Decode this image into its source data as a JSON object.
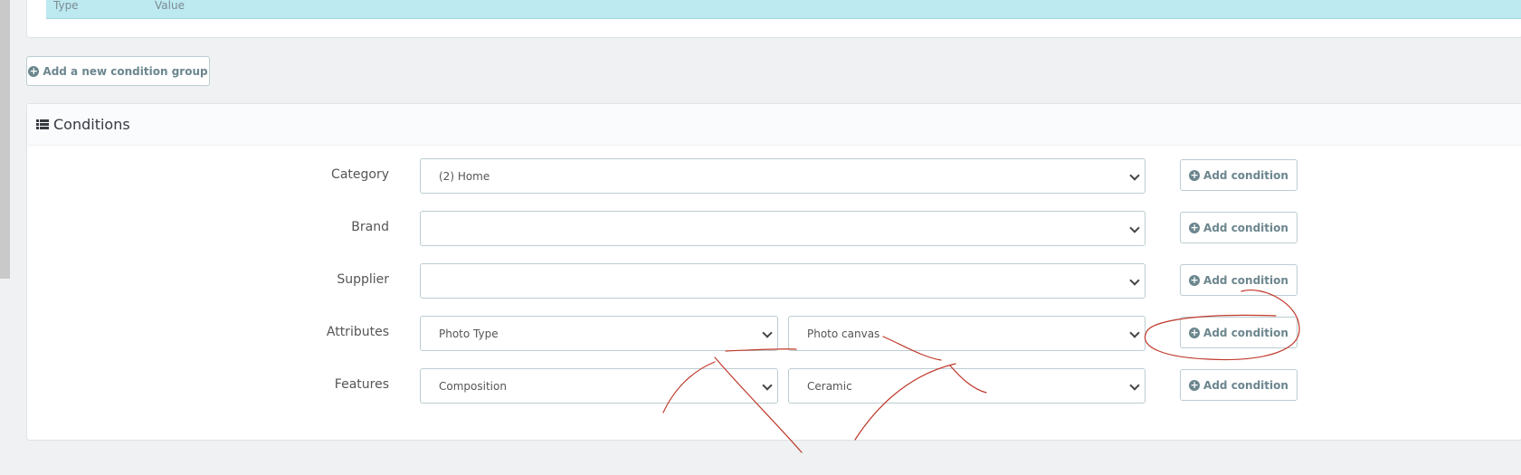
{
  "top_table": {
    "col_type": "Type",
    "col_value": "Value"
  },
  "new_group_button": {
    "label": "Add a new condition group",
    "icon": "plus-circle-icon"
  },
  "conditions": {
    "title": "Conditions",
    "icon": "list-icon",
    "rows": [
      {
        "label": "Category",
        "select1": "(2) Home",
        "button": "Add condition"
      },
      {
        "label": "Brand",
        "select1": "",
        "button": "Add condition"
      },
      {
        "label": "Supplier",
        "select1": "",
        "button": "Add condition"
      },
      {
        "label": "Attributes",
        "select1": "Photo Type",
        "select2": "Photo canvas",
        "button": "Add condition"
      },
      {
        "label": "Features",
        "select1": "Composition",
        "select2": "Ceramic",
        "button": "Add condition"
      }
    ]
  },
  "colors": {
    "annotation": "#c0392b",
    "table_head": "#bde9f1",
    "button_text": "#6c868e"
  }
}
